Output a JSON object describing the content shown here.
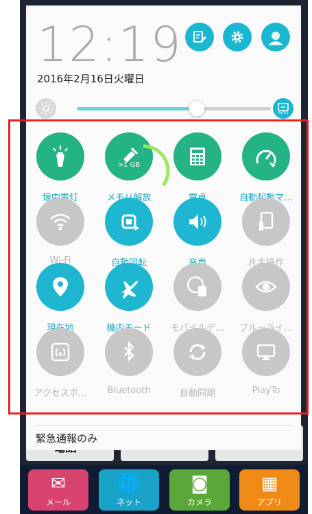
{
  "status": {
    "time": "12:19",
    "date": "2016年2月16日火曜日"
  },
  "header_buttons": [
    {
      "name": "memo-icon",
      "color": "#19b8d0"
    },
    {
      "name": "settings-icon",
      "color": "#19b8d0"
    },
    {
      "name": "user-icon",
      "color": "#19b8d0"
    }
  ],
  "brightness": {
    "level": 0.62,
    "auto_label": "AUTO"
  },
  "tiles": [
    {
      "label": "懐中電灯",
      "icon": "flashlight-icon",
      "state": "on",
      "color": "#23b385"
    },
    {
      "label": "メモリ解放",
      "icon": "memory-boost-icon",
      "state": "on",
      "color": "#23b385",
      "badge": ">1 GB"
    },
    {
      "label": "電卓",
      "icon": "calculator-icon",
      "state": "on",
      "color": "#23b385"
    },
    {
      "label": "自動起動マ…",
      "icon": "auto-start-manager-icon",
      "state": "on",
      "color": "#23b385"
    },
    {
      "label": "Wi-Fi",
      "icon": "wifi-icon",
      "state": "off",
      "color": "#c7c7c7"
    },
    {
      "label": "自動回転",
      "icon": "auto-rotate-icon",
      "state": "on",
      "color": "#1eb6d1"
    },
    {
      "label": "音声",
      "icon": "sound-icon",
      "state": "on",
      "color": "#1eb6d1"
    },
    {
      "label": "片手操作",
      "icon": "one-hand-icon",
      "state": "off",
      "color": "#c7c7c7"
    },
    {
      "label": "現在地",
      "icon": "location-icon",
      "state": "on",
      "color": "#1eb6d1"
    },
    {
      "label": "機内モード",
      "icon": "airplane-icon",
      "state": "on",
      "color": "#1eb6d1"
    },
    {
      "label": "モバイルデ…",
      "icon": "mobile-data-icon",
      "state": "off",
      "color": "#c7c7c7"
    },
    {
      "label": "ブルーライ…",
      "icon": "bluelight-filter-icon",
      "state": "off",
      "color": "#c7c7c7"
    },
    {
      "label": "アクセスポ…",
      "icon": "hotspot-icon",
      "state": "off",
      "color": "#c7c7c7"
    },
    {
      "label": "Bluetooth",
      "icon": "bluetooth-icon",
      "state": "off",
      "color": "#c7c7c7"
    },
    {
      "label": "自動同期",
      "icon": "sync-icon",
      "state": "off",
      "color": "#c7c7c7"
    },
    {
      "label": "PlayTo",
      "icon": "playto-icon",
      "state": "off",
      "color": "#c7c7c7"
    }
  ],
  "memory_usage": 0.35,
  "emergency_text": "緊急通報のみ",
  "home": {
    "button_label": "電話",
    "dock": [
      {
        "label": "メール",
        "icon": "mail-icon",
        "color": "#d9436f"
      },
      {
        "label": "ネット",
        "icon": "globe-icon",
        "color": "#1aa3c9"
      },
      {
        "label": "カメラ",
        "icon": "camera-icon",
        "color": "#5aa83a"
      },
      {
        "label": "アプリ",
        "icon": "apps-icon",
        "color": "#f08a17"
      }
    ]
  },
  "highlight_color": "#e8201f"
}
